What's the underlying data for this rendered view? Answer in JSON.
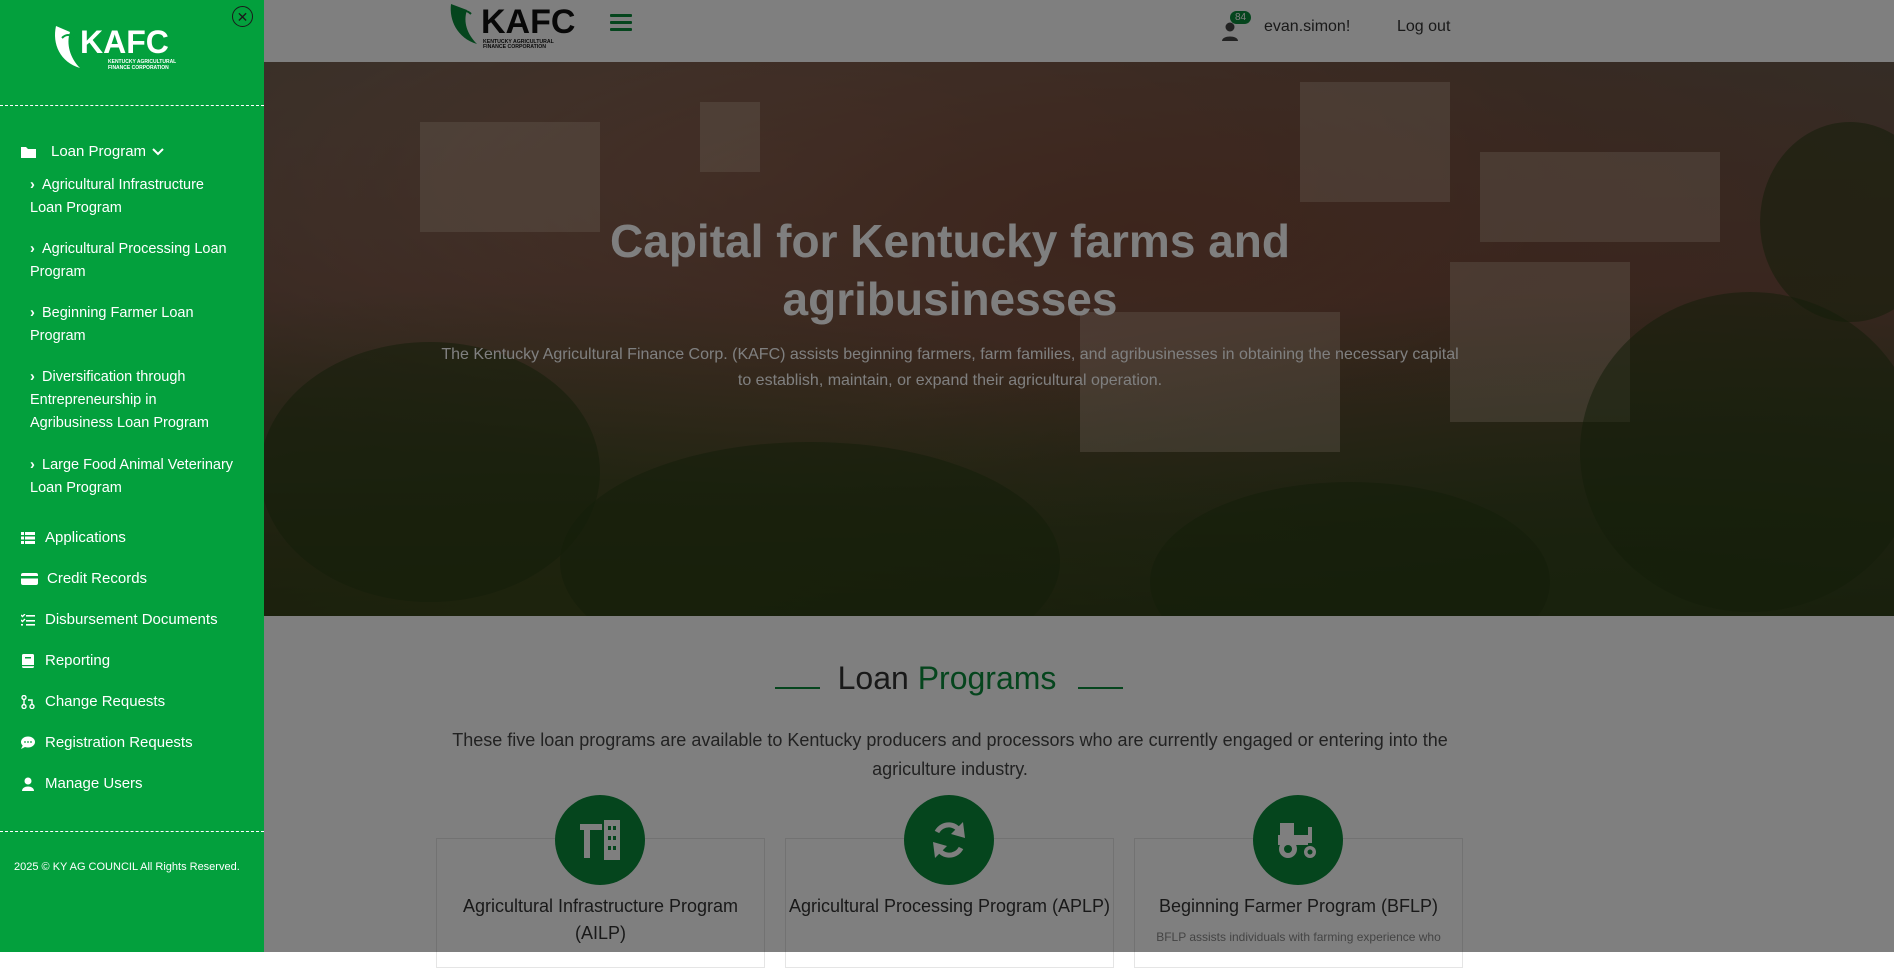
{
  "topbar": {
    "logo_text": "KAFC",
    "logo_subtext": "KENTUCKY AGRICULTURAL FINANCE CORPORATION",
    "notification_count": "84",
    "username": "evan.simon!",
    "logout_label": "Log out"
  },
  "hero": {
    "title": "Capital for Kentucky farms and agribusinesses",
    "subtitle": "The Kentucky Agricultural Finance Corp. (KAFC) assists beginning farmers, farm families, and agribusinesses in obtaining the necessary capital to establish, maintain, or expand their agricultural operation."
  },
  "programs": {
    "title_prefix": "Loan",
    "title_highlight": "Programs",
    "description": "These five loan programs are available to Kentucky producers and processors who are currently engaged or entering into the agriculture industry.",
    "cards": [
      {
        "title": "Agricultural Infrastructure Program (AILP)",
        "text": "",
        "icon": "farm-building-icon"
      },
      {
        "title": "Agricultural Processing Program (APLP)",
        "text": "",
        "icon": "refresh-icon"
      },
      {
        "title": "Beginning Farmer Program (BFLP)",
        "text": "BFLP assists individuals with farming experience who",
        "icon": "tractor-icon"
      }
    ]
  },
  "sidebar": {
    "logo_text": "KAFC",
    "logo_subtext": "KENTUCKY AGRICULTURAL FINANCE CORPORATION",
    "loan_program_label": "Loan Program",
    "loan_sub_items": [
      "Agricultural Infrastructure Loan Program",
      "Agricultural Processing Loan Program",
      "Beginning Farmer Loan Program",
      "Diversification through Entrepreneurship in Agribusiness Loan Program",
      "Large Food Animal Veterinary Loan Program"
    ],
    "items": [
      {
        "label": "Applications",
        "icon": "table-list-icon"
      },
      {
        "label": "Credit Records",
        "icon": "credit-card-icon"
      },
      {
        "label": "Disbursement Documents",
        "icon": "checklist-icon"
      },
      {
        "label": "Reporting",
        "icon": "book-icon"
      },
      {
        "label": "Change Requests",
        "icon": "code-pull-icon"
      },
      {
        "label": "Registration Requests",
        "icon": "comment-icon"
      },
      {
        "label": "Manage Users",
        "icon": "user-icon"
      }
    ],
    "footer": "2025 © KY AG COUNCIL All Rights Reserved."
  },
  "colors": {
    "brand_green": "#03a03d",
    "accent_green": "#0a8a3a"
  }
}
